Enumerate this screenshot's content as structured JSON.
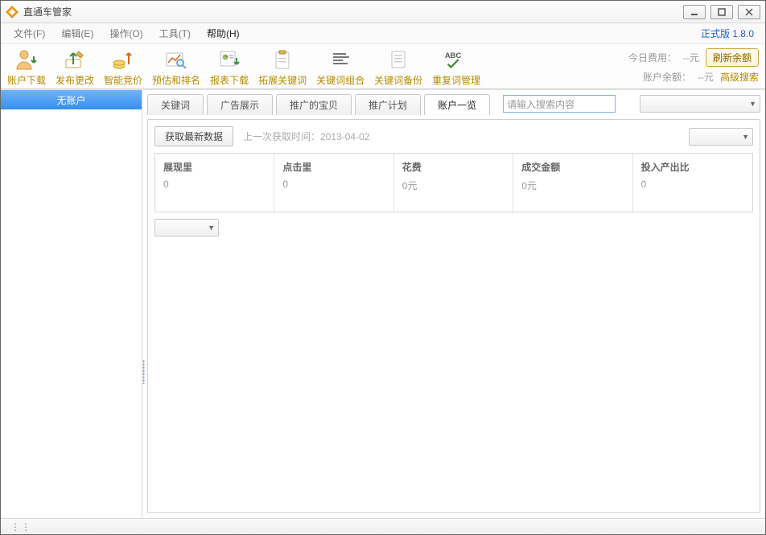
{
  "window": {
    "title": "直通车管家"
  },
  "menu": {
    "items": [
      "文件(F)",
      "编辑(E)",
      "操作(O)",
      "工具(T)",
      "帮助(H)"
    ],
    "active_index": 4,
    "version_label": "正式版 1.8.0"
  },
  "toolbar": {
    "buttons": [
      {
        "id": "download-account",
        "label": "账户下载"
      },
      {
        "id": "publish-changes",
        "label": "发布更改"
      },
      {
        "id": "smart-bid",
        "label": "智能竞价"
      },
      {
        "id": "estimate-rank",
        "label": "预估和排名"
      },
      {
        "id": "report-download",
        "label": "报表下载"
      },
      {
        "id": "expand-keywords",
        "label": "拓展关键词"
      },
      {
        "id": "keyword-combo",
        "label": "关键词组合"
      },
      {
        "id": "keyword-backup",
        "label": "关键词备份"
      },
      {
        "id": "dup-keyword-manage",
        "label": "重复词管理"
      }
    ],
    "today_cost_label": "今日费用：",
    "today_cost_value": "--元",
    "balance_label": "账户余额：",
    "balance_value": "--元",
    "refresh_label": "刷新余额",
    "advanced_search_label": "高级搜索"
  },
  "sidebar": {
    "items": [
      "无账户"
    ]
  },
  "tabs": {
    "items": [
      "关键词",
      "广告展示",
      "推广的宝贝",
      "推广计划",
      "账户一览"
    ],
    "active_index": 4
  },
  "search": {
    "placeholder": "请输入搜索内容"
  },
  "panel": {
    "fetch_button": "获取最新数据",
    "last_fetch_prefix": "上一次获取时间：",
    "last_fetch_time": "2013-04-02",
    "stats": [
      {
        "label": "展现里",
        "value": "0"
      },
      {
        "label": "点击里",
        "value": "0"
      },
      {
        "label": "花费",
        "value": "0元"
      },
      {
        "label": "成交金额",
        "value": "0元"
      },
      {
        "label": "投入产出比",
        "value": "0"
      }
    ]
  },
  "statusbar": {
    "text": ""
  }
}
